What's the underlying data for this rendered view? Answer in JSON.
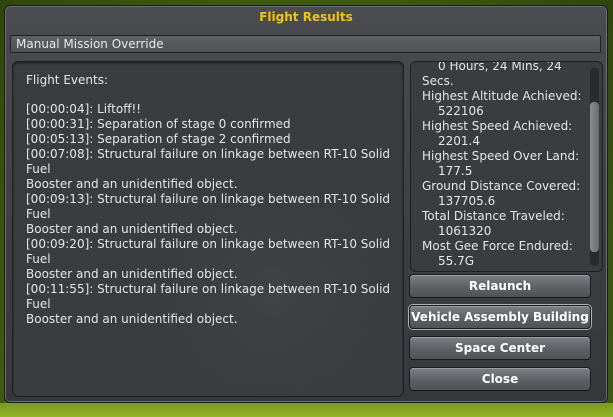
{
  "window": {
    "title": "Flight Results",
    "subheader": "Manual Mission Override"
  },
  "events": {
    "heading": "Flight Events:",
    "items": [
      "[00:00:04]: Liftoff!!",
      "[00:00:31]: Separation of stage 0 confirmed",
      "[00:05:13]: Separation of stage 2 confirmed",
      "[00:07:08]: Structural failure on linkage between RT-10 Solid Fuel",
      "Booster and an unidentified object.",
      "[00:09:13]: Structural failure on linkage between RT-10 Solid Fuel",
      "Booster and an unidentified object.",
      "[00:09:20]: Structural failure on linkage between RT-10 Solid Fuel",
      "Booster and an unidentified object.",
      "[00:11:55]: Structural failure on linkage between RT-10 Solid Fuel",
      "Booster and an unidentified object."
    ]
  },
  "stats": {
    "time_line1": "0 Hours, 24 Mins, 24",
    "time_line2": "Secs.",
    "items": [
      {
        "label": "Highest Altitude Achieved:",
        "value": "522106"
      },
      {
        "label": "Highest Speed Achieved:",
        "value": "2201.4"
      },
      {
        "label": "Highest Speed Over Land:",
        "value": "177.5"
      },
      {
        "label": "Ground Distance Covered:",
        "value": "137705.6"
      },
      {
        "label": "Total Distance Traveled:",
        "value": "1061320"
      },
      {
        "label": "Most Gee Force Endured:",
        "value": "55.7G"
      }
    ]
  },
  "buttons": {
    "relaunch": "Relaunch",
    "vab": "Vehicle Assembly Building",
    "space_center": "Space Center",
    "close": "Close"
  },
  "colors": {
    "title": "#f2c21a",
    "panel": "#3a3c40",
    "text": "#e6e6e6"
  }
}
